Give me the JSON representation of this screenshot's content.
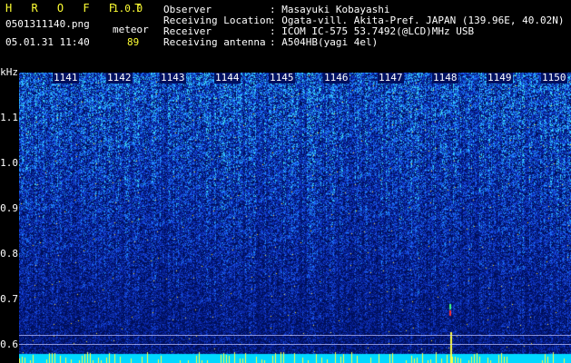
{
  "app": {
    "title": "H R O F F T",
    "version": "1.0.0"
  },
  "file": {
    "name": "0501311140.png",
    "datetime": "05.01.31 11:40"
  },
  "meteor": {
    "label": "meteor",
    "count": "89"
  },
  "station": {
    "rows": [
      {
        "label": "Observer",
        "value": ": Masayuki Kobayashi"
      },
      {
        "label": "Receiving Location",
        "value": ": Ogata-vill. Akita-Pref. JAPAN (139.96E, 40.02N)"
      },
      {
        "label": "Receiver",
        "value": ": ICOM IC-575 53.7492(@LCD)MHz USB"
      },
      {
        "label": "Receiving antenna",
        "value": ": A504HB(yagi 4el)"
      }
    ]
  },
  "axis": {
    "unit": "kHz",
    "ticks": [
      "1.1",
      "1.0",
      "0.9",
      "0.8",
      "0.7",
      "0.6"
    ],
    "minutes": [
      "1141",
      "1142",
      "1143",
      "1144",
      "1145",
      "1146",
      "1147",
      "1148",
      "1149",
      "1150"
    ]
  },
  "colors": {
    "background": "#000000",
    "title": "#ffff33",
    "noise_deep": "#001a80",
    "noise_mid": "#1f4fe0",
    "noise_high": "#30c0ff",
    "bottom_band": "#00d8ff",
    "meteor_spike": "#ffff40"
  }
}
